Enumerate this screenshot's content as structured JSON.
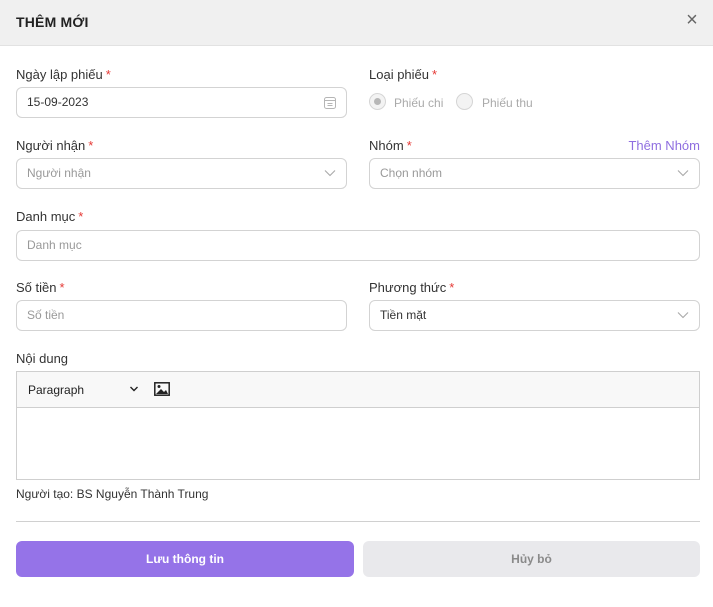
{
  "header": {
    "title": "THÊM MỚI",
    "close_icon": "×"
  },
  "form": {
    "ngay_lap_phieu": {
      "label": "Ngày lập phiếu",
      "required": "*",
      "value": "15-09-2023",
      "icon": "calendar-icon"
    },
    "loai_phieu": {
      "label": "Loại phiếu",
      "required": "*",
      "options": [
        {
          "label": "Phiếu chi",
          "selected": true
        },
        {
          "label": "Phiếu thu",
          "selected": false
        }
      ]
    },
    "nguoi_nhan": {
      "label": "Người nhận",
      "required": "*",
      "placeholder": "Người nhận",
      "icon": "chevron-down-icon"
    },
    "nhom": {
      "label": "Nhóm",
      "required": "*",
      "placeholder": "Chọn nhóm",
      "add_link": "Thêm Nhóm",
      "icon": "chevron-down-icon"
    },
    "danh_muc": {
      "label": "Danh mục",
      "required": "*",
      "placeholder": "Danh mục"
    },
    "so_tien": {
      "label": "Số tiền",
      "required": "*",
      "placeholder": "Số tiền"
    },
    "phuong_thuc": {
      "label": "Phương thức",
      "required": "*",
      "value": "Tiền mặt",
      "icon": "chevron-down-icon"
    },
    "noi_dung": {
      "label": "Nội dung",
      "format": "Paragraph",
      "icons": [
        "chevron-down-icon",
        "image-icon"
      ]
    }
  },
  "creator": "Người tạo: BS Nguyễn Thành Trung",
  "buttons": {
    "save": "Lưu thông tin",
    "cancel": "Hủy bỏ"
  },
  "colors": {
    "accent": "#9573e8",
    "link": "#8f6ee0",
    "required": "#e53935",
    "header_bg": "#f0f0f0",
    "cancel_bg": "#e9e9ec"
  }
}
